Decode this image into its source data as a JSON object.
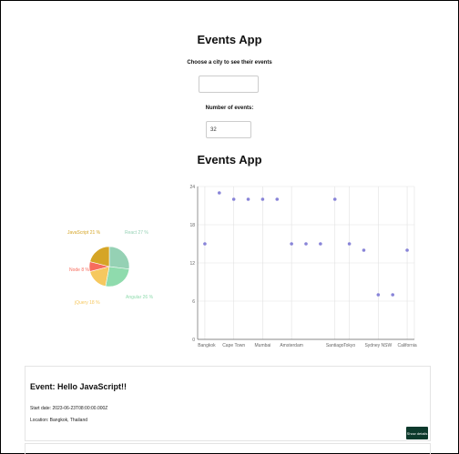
{
  "app_title": "Events App",
  "city_label": "Choose a city to see their events",
  "city_value": "",
  "number_label": "Number of events:",
  "number_value": "32",
  "chart_heading": "Events App",
  "pie_chart": {
    "type": "pie",
    "slices": [
      {
        "label": "React 27 %",
        "value": 27,
        "color": "#95d1b4"
      },
      {
        "label": "Angular 26 %",
        "value": 26,
        "color": "#8fdbad"
      },
      {
        "label": "jQuery 18 %",
        "value": 18,
        "color": "#f6c85f"
      },
      {
        "label": "Node 8 %",
        "value": 8,
        "color": "#f76c5e"
      },
      {
        "label": "JavaScript 21 %",
        "value": 21,
        "color": "#d5a526"
      }
    ]
  },
  "chart_data": {
    "type": "scatter",
    "x": [
      "Bangkok",
      "",
      "Cape Town",
      "",
      "Mumbai",
      "",
      "Amsterdam",
      "",
      "",
      "Santiago",
      "Tokyo",
      "",
      "Sydney NSW",
      "",
      "California"
    ],
    "tick_labels": [
      "Bangkok",
      "Cape Town",
      "Mumbai",
      "Amsterdam",
      "Santiago",
      "Tokyo",
      "Sydney NSW",
      "California"
    ],
    "y": [
      15,
      23,
      22,
      22,
      22,
      22,
      15,
      15,
      15,
      22,
      15,
      14,
      7,
      7,
      14
    ],
    "ylim": [
      0,
      24
    ],
    "yticks": [
      0,
      6,
      12,
      18,
      24
    ],
    "point_color": "#8884d8",
    "grid": true
  },
  "event": {
    "title": "Event: Hello JavaScript!!",
    "start": "Start date: 2023-06-23T08:00:00.000Z",
    "location": "Location: Bangkok, Thailand",
    "button": "Show details"
  }
}
